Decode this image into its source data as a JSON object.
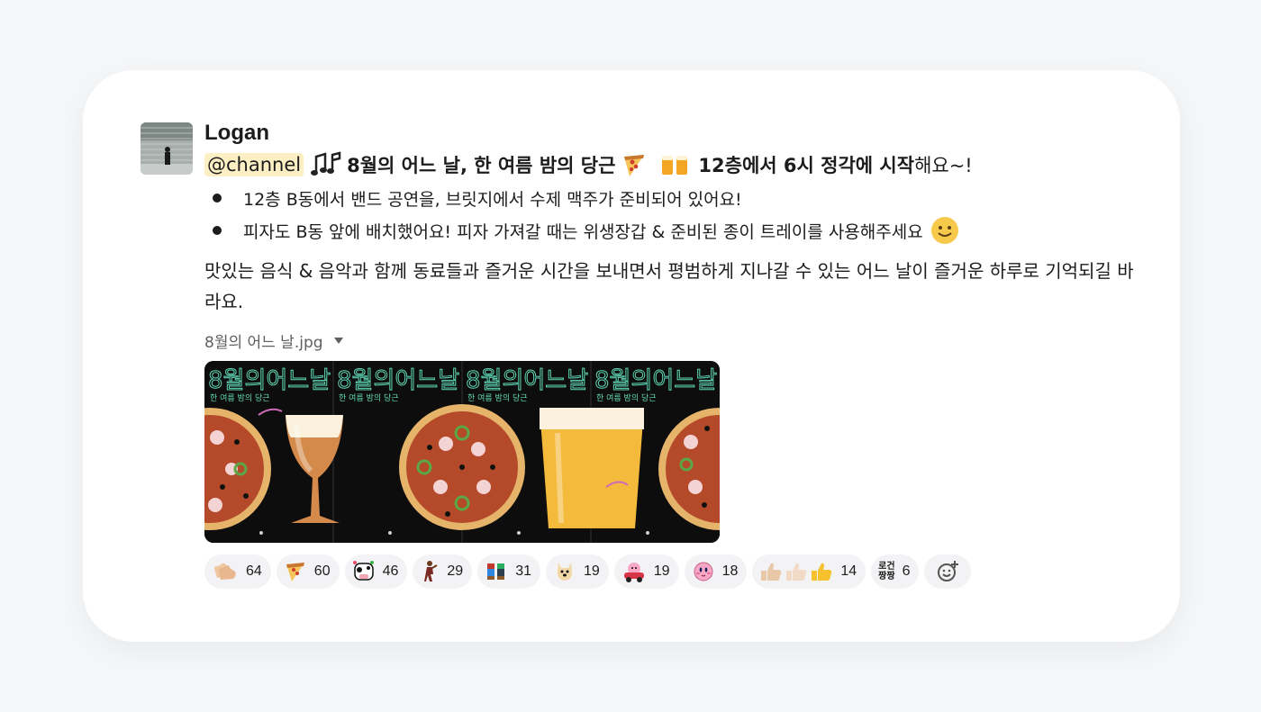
{
  "message": {
    "author": "Logan",
    "mention": "@channel",
    "headline_bold_1": "8월의 어느 날, 한 여름 밤의 당근",
    "headline_bold_2": "12층에서 6시 정각에 시작",
    "headline_tail": "해요~!",
    "bullets": [
      "12층 B동에서 밴드 공연을, 브릿지에서 수제 맥주가 준비되어 있어요!",
      "피자도 B동 앞에 배치했어요! 피자 가져갈 때는 위생장갑 & 준비된 종이 트레이를 사용해주세요"
    ],
    "paragraph": "맛있는 음식 & 음악과 함께 동료들과 즐거운 시간을 보내면서 평범하게 지나갈 수 있는 어느 날이 즐거운 하루로 기억되길 바라요.",
    "attachment_name": "8월의 어느 날.jpg",
    "poster": {
      "title": "8월의어느날",
      "subtitle": "한 여름 밤의 당근"
    }
  },
  "reactions": [
    {
      "icon": "clap-icon",
      "count": "64"
    },
    {
      "icon": "pizza-icon",
      "count": "60"
    },
    {
      "icon": "cow-party-icon",
      "count": "46"
    },
    {
      "icon": "dancer-icon",
      "count": "29"
    },
    {
      "icon": "pixel-people-icon",
      "count": "31"
    },
    {
      "icon": "dog-icon",
      "count": "19"
    },
    {
      "icon": "kirby-car-icon",
      "count": "19"
    },
    {
      "icon": "kirby-icon",
      "count": "18"
    },
    {
      "icon": "thumbs-up-trio-icon",
      "count": "14"
    },
    {
      "icon": "ganbaru-icon",
      "label_1": "로건",
      "label_2": "짱짱",
      "count": "6"
    }
  ],
  "colors": {
    "mention_bg": "#fcefc4",
    "reaction_bg": "#f3f3f5",
    "poster_bg": "#0d0d0d",
    "poster_text": "#5fd6b3"
  }
}
